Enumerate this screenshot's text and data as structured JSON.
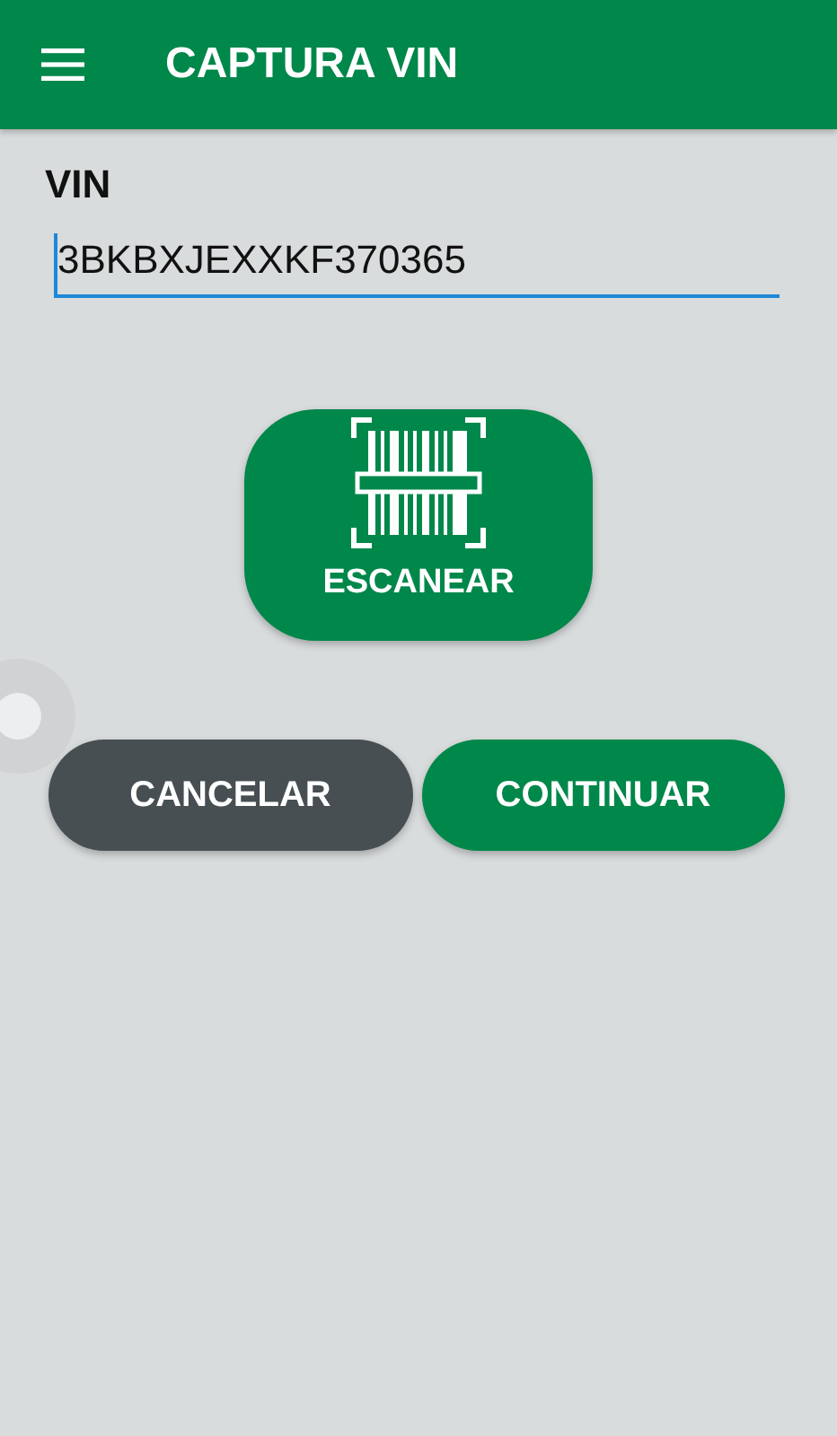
{
  "app_bar": {
    "title": "CAPTURA VIN"
  },
  "vin_field": {
    "label": "VIN",
    "value": "3BKBXJEXXKF370365"
  },
  "scan_button": {
    "label": "ESCANEAR"
  },
  "buttons": [
    {
      "label": "CANCELAR",
      "kind": "secondary"
    },
    {
      "label": "CONTINUAR",
      "kind": "primary"
    }
  ]
}
